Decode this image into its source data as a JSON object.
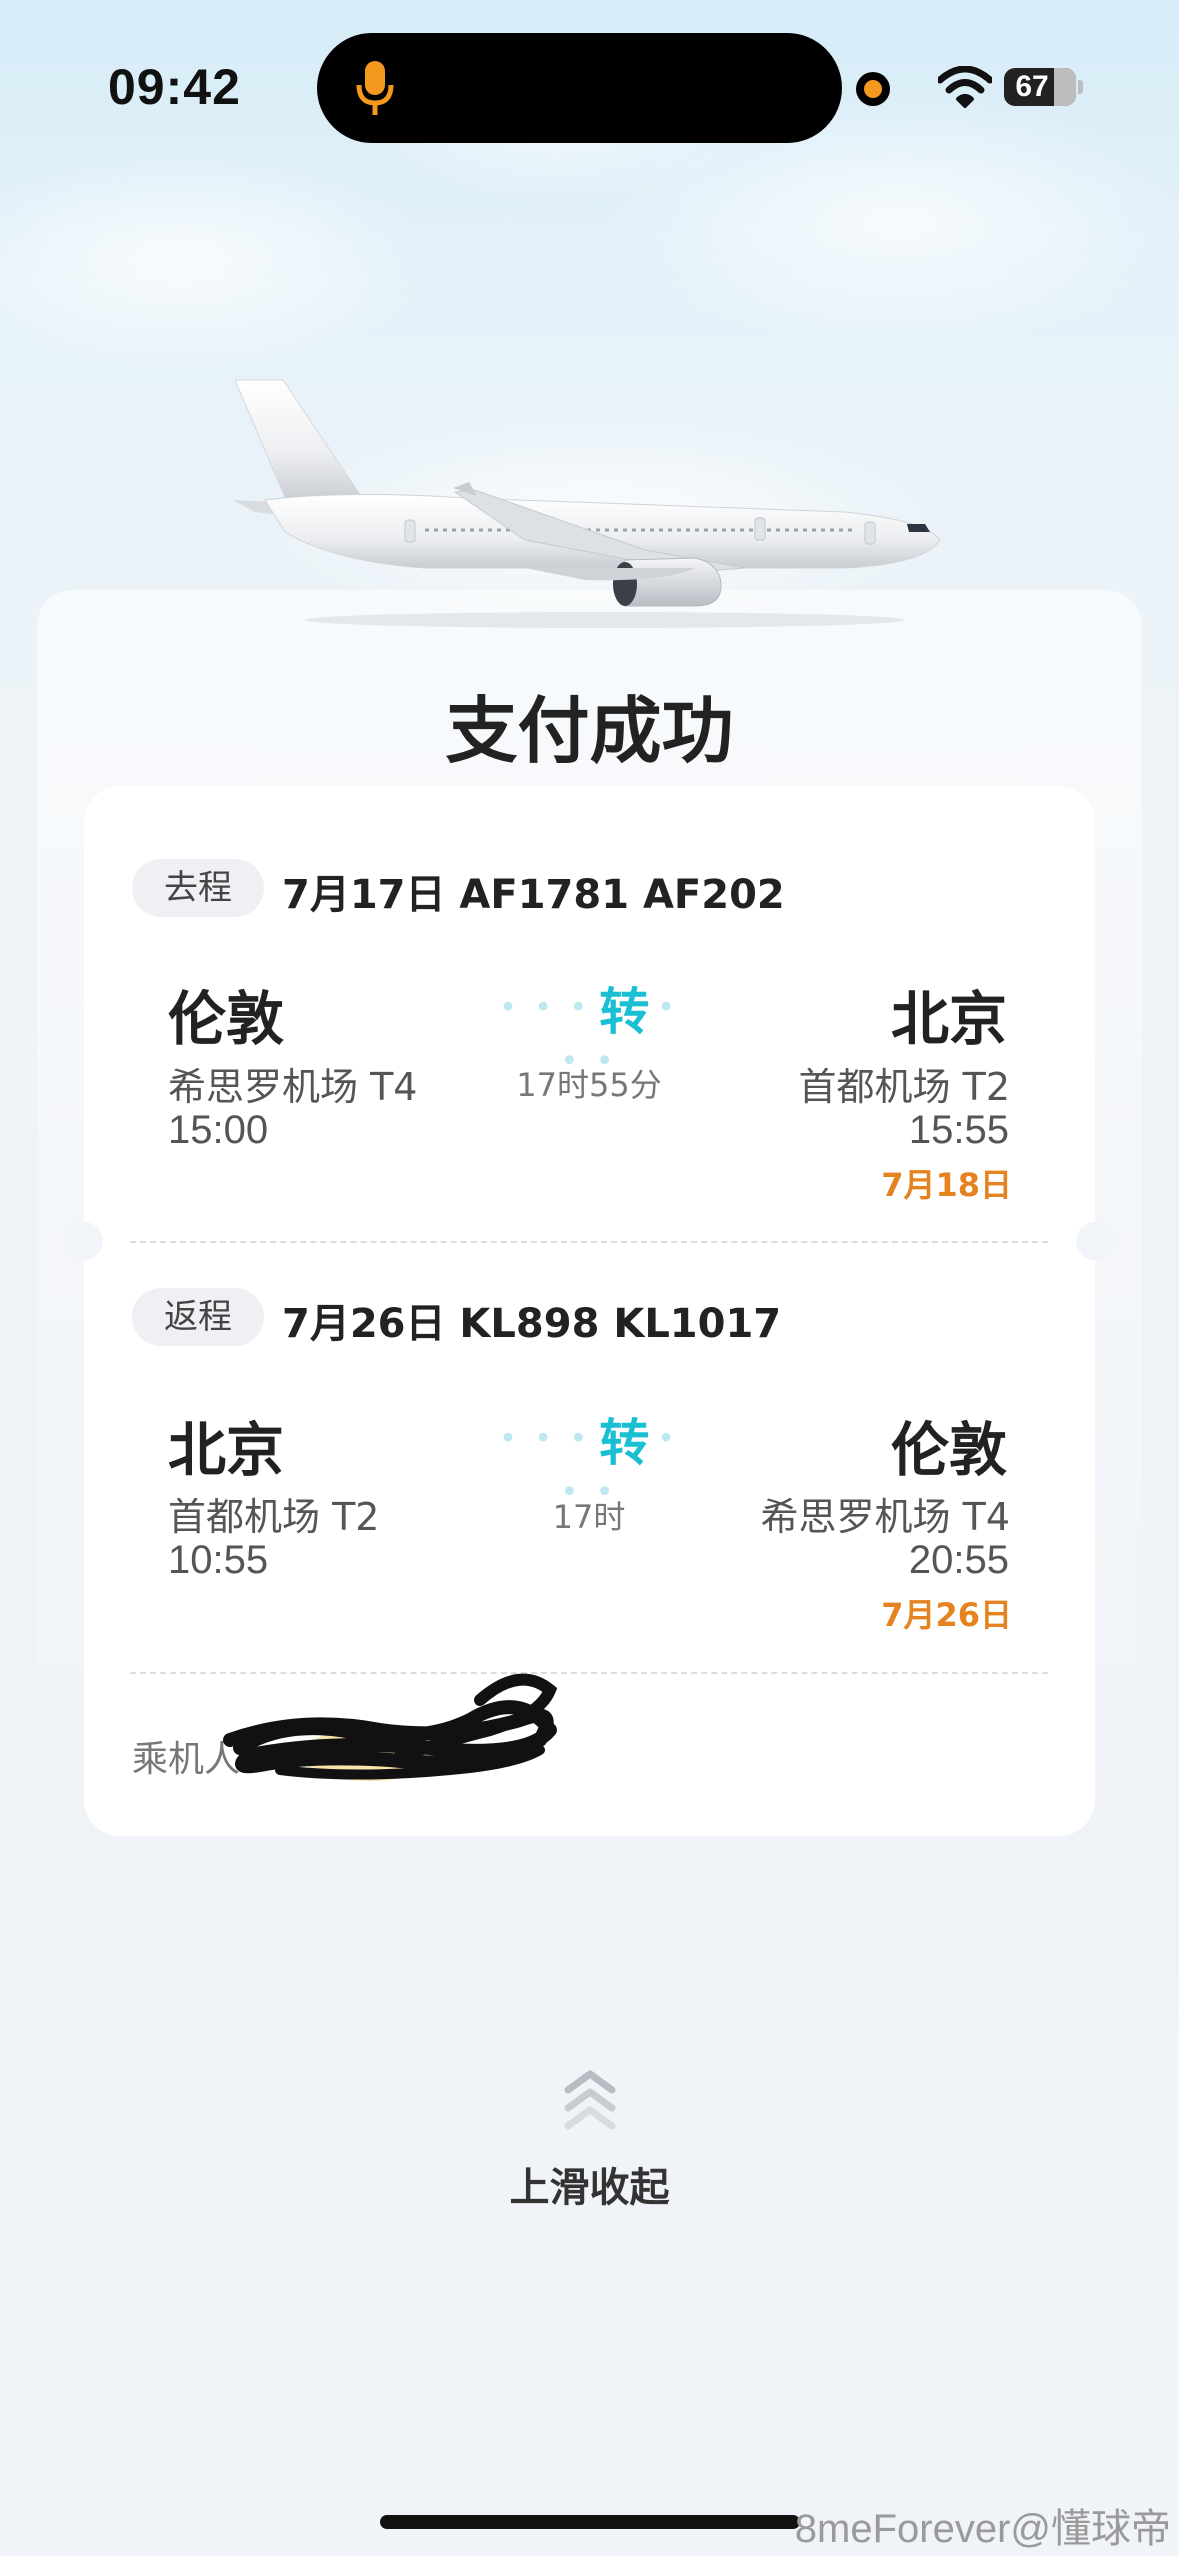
{
  "status_bar": {
    "time": "09:42",
    "battery": "67",
    "mic_color": "#f39a1e"
  },
  "title": "支付成功",
  "outbound": {
    "tag": "去程",
    "summary": "7月17日 AF1781 AF202",
    "from": {
      "city": "伦敦",
      "airport": "希思罗机场 T4",
      "time": "15:00"
    },
    "transfer": {
      "label": "转",
      "duration": "17时55分"
    },
    "to": {
      "city": "北京",
      "airport": "首都机场 T2",
      "time": "15:55",
      "date": "7月18日"
    }
  },
  "return": {
    "tag": "返程",
    "summary": "7月26日 KL898 KL1017",
    "from": {
      "city": "北京",
      "airport": "首都机场 T2",
      "time": "10:55"
    },
    "transfer": {
      "label": "转",
      "duration": "17时"
    },
    "to": {
      "city": "伦敦",
      "airport": "希思罗机场 T4",
      "time": "20:55",
      "date": "7月26日"
    }
  },
  "passenger_label": "乘机人",
  "swipe_label": "上滑收起",
  "watermark": "8meForever@懂球帝",
  "colors": {
    "accent": "#19bfd2",
    "date": "#e58320"
  }
}
